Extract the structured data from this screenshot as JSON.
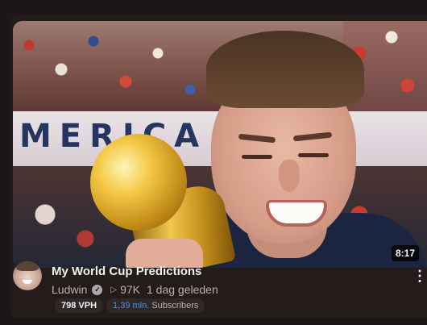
{
  "video": {
    "title": "My World Cup Predictions",
    "duration": "8:17",
    "thumbnail_banner_text": "MERICA"
  },
  "channel": {
    "name": "Ludwin",
    "verified_icon": "verified-check-icon"
  },
  "stats": {
    "views_icon": "play-icon",
    "views": "97K",
    "age": "1 dag geleden"
  },
  "badges": {
    "vph": "798 VPH",
    "subscriber_count": "1,39 mln.",
    "subscriber_label": "Subscribers"
  },
  "menu": {
    "more_icon": "more-dots-icon"
  },
  "colors": {
    "background": "#1c1717",
    "card": "#241b1b",
    "accent_blue": "#4f8fe0"
  }
}
